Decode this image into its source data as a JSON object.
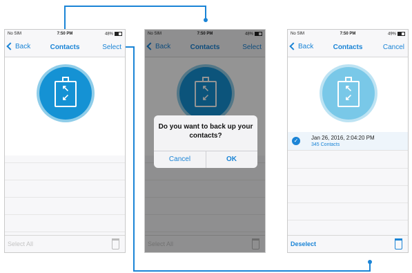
{
  "status": {
    "carrier": "No SIM",
    "time": "7:50 PM",
    "battery_1": "48%",
    "battery_2": "48%",
    "battery_3": "49%"
  },
  "screen1": {
    "back": "Back",
    "title": "Contacts",
    "right": "Select",
    "toolbar_left": "Select All"
  },
  "screen2": {
    "back": "Back",
    "title": "Contacts",
    "right": "Select",
    "toolbar_left": "Select All",
    "alert_message": "Do you want to back up your contacts?",
    "cancel": "Cancel",
    "ok": "OK"
  },
  "screen3": {
    "back": "Back",
    "title": "Contacts",
    "right": "Cancel",
    "backup_date": "Jan 26, 2016, 2:04:20 PM",
    "backup_count": "345 Contacts",
    "toolbar_left": "Deselect"
  },
  "colors": {
    "accent": "#1a84d6",
    "dim_overlay": "rgba(0,0,0,0.42)"
  },
  "icons": [
    "chevron-left-icon",
    "backup-jar-icon",
    "trash-icon",
    "checkmark-icon"
  ]
}
